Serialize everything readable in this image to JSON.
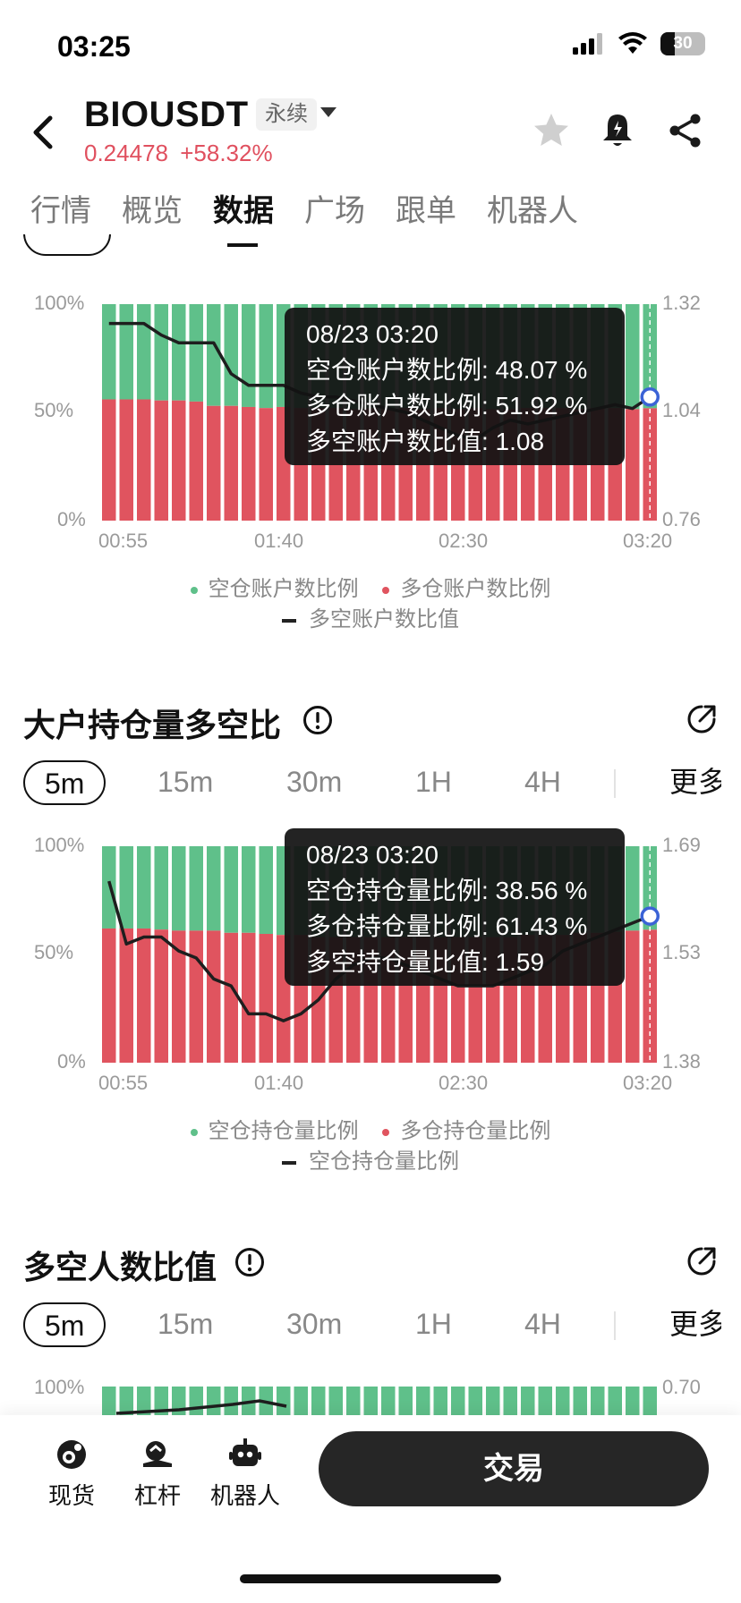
{
  "status_bar": {
    "time": "03:25",
    "battery": "30"
  },
  "header": {
    "symbol": "BIOUSDT",
    "contract_type": "永续",
    "price": "0.24478",
    "change": "+58.32%"
  },
  "tabs": [
    "行情",
    "概览",
    "数据",
    "广场",
    "跟单",
    "机器人"
  ],
  "active_tab": "数据",
  "intervals": [
    "5m",
    "15m",
    "30m",
    "1H",
    "4H",
    "更多"
  ],
  "colors": {
    "green": "#5fc08a",
    "red": "#e0545f",
    "line": "#1e1e1e",
    "marker": "#3b63d6",
    "up_text": "#e0505f"
  },
  "charts": [
    {
      "y_left": [
        "100%",
        "50%",
        "0%"
      ],
      "y_right": [
        "1.32",
        "1.04",
        "0.76"
      ],
      "x_ticks": [
        "00:55",
        "01:40",
        "02:30",
        "03:20"
      ],
      "tooltip": {
        "time": "08/23 03:20",
        "row1": "空仓账户数比例: 48.07 %",
        "row2": "多仓账户数比例: 51.92 %",
        "row3": "多空账户数比值: 1.08"
      },
      "legend": {
        "green": "空仓账户数比例",
        "red": "多仓账户数比例",
        "line": "多空账户数比值"
      }
    },
    {
      "title": "大户持仓量多空比",
      "y_left": [
        "100%",
        "50%",
        "0%"
      ],
      "y_right": [
        "1.69",
        "1.53",
        "1.38"
      ],
      "x_ticks": [
        "00:55",
        "01:40",
        "02:30",
        "03:20"
      ],
      "tooltip": {
        "time": "08/23 03:20",
        "row1": "空仓持仓量比例: 38.56 %",
        "row2": "多仓持仓量比例: 61.43 %",
        "row3": "多空持仓量比值: 1.59"
      },
      "legend": {
        "green": "空仓持仓量比例",
        "red": "多仓持仓量比例",
        "line": "空仓持仓量比例"
      }
    },
    {
      "title": "多空人数比值",
      "y_left": [
        "100%"
      ],
      "y_right": [
        "0.70"
      ]
    }
  ],
  "chart_data": [
    {
      "type": "bar",
      "stacked": true,
      "series": [
        {
          "name": "多仓账户数比例",
          "values": [
            56,
            56,
            56,
            55.5,
            55.5,
            55,
            53,
            53,
            52.5,
            52,
            52.5,
            52,
            52,
            52,
            51.5,
            52,
            51.5,
            52,
            51.5,
            52,
            51.5,
            52,
            51.5,
            51.5,
            52,
            52,
            52,
            51.5,
            52,
            52,
            51.5,
            51.92
          ]
        },
        {
          "name": "空仓账户数比例",
          "values": [
            44,
            44,
            44,
            44.5,
            44.5,
            45,
            47,
            47,
            47.5,
            48,
            47.5,
            48,
            48,
            48,
            48.5,
            48,
            48.5,
            48,
            48.5,
            48,
            48.5,
            48,
            48.5,
            48.5,
            48,
            48,
            48,
            48.5,
            48,
            48,
            48.5,
            48.07
          ]
        },
        {
          "name": "多空账户数比值",
          "type": "line",
          "values": [
            1.27,
            1.27,
            1.27,
            1.24,
            1.22,
            1.22,
            1.22,
            1.14,
            1.11,
            1.11,
            1.11,
            1.09,
            1.08,
            1.08,
            1.07,
            1.06,
            1.05,
            1.04,
            1.02,
            1.0,
            0.98,
            0.97,
            1.0,
            1.02,
            1.01,
            1.02,
            1.03,
            1.04,
            1.05,
            1.06,
            1.05,
            1.08
          ]
        }
      ],
      "ylim": [
        0,
        100
      ],
      "y2lim": [
        0.76,
        1.32
      ],
      "x_ticks": [
        "00:55",
        "01:40",
        "02:30",
        "03:20"
      ]
    },
    {
      "type": "bar",
      "stacked": true,
      "series": [
        {
          "name": "多仓持仓量比例",
          "values": [
            62,
            62,
            62,
            61.5,
            61,
            61,
            61,
            60,
            60,
            59.5,
            59,
            59,
            58,
            58,
            58,
            58,
            58,
            58,
            58,
            58,
            58,
            58,
            58,
            58,
            59,
            59,
            59,
            60,
            60,
            60.5,
            61,
            61.43
          ]
        },
        {
          "name": "空仓持仓量比例",
          "values": [
            38,
            38,
            38,
            38.5,
            39,
            39,
            39,
            40,
            40,
            40.5,
            41,
            41,
            42,
            42,
            42,
            42,
            42,
            42,
            42,
            42,
            42,
            42,
            42,
            42,
            41,
            41,
            41,
            40,
            40,
            39.5,
            39,
            38.56
          ]
        },
        {
          "name": "空仓持仓量比例",
          "type": "line",
          "values": [
            1.64,
            1.55,
            1.56,
            1.56,
            1.54,
            1.53,
            1.5,
            1.49,
            1.45,
            1.45,
            1.44,
            1.45,
            1.47,
            1.5,
            1.52,
            1.53,
            1.53,
            1.52,
            1.51,
            1.5,
            1.49,
            1.49,
            1.49,
            1.5,
            1.51,
            1.52,
            1.54,
            1.55,
            1.56,
            1.57,
            1.58,
            1.59
          ]
        }
      ],
      "ylim": [
        0,
        100
      ],
      "y2lim": [
        1.38,
        1.69
      ],
      "x_ticks": [
        "00:55",
        "01:40",
        "02:30",
        "03:20"
      ]
    }
  ]
}
